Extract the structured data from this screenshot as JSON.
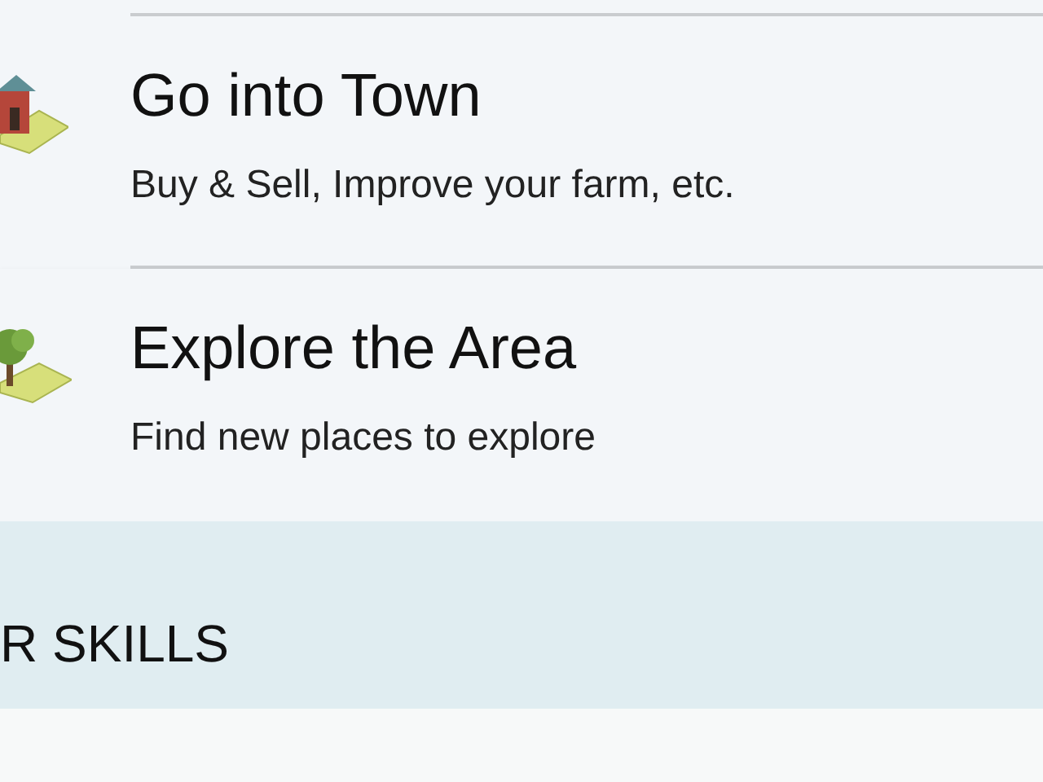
{
  "actions": [
    {
      "kind": "building",
      "title": "Go into Town",
      "subtitle": "Buy & Sell, Improve your farm, etc."
    },
    {
      "kind": "tree",
      "title": "Explore the Area",
      "subtitle": "Find new places to explore"
    }
  ],
  "section_header": {
    "title": "R SKILLS"
  }
}
